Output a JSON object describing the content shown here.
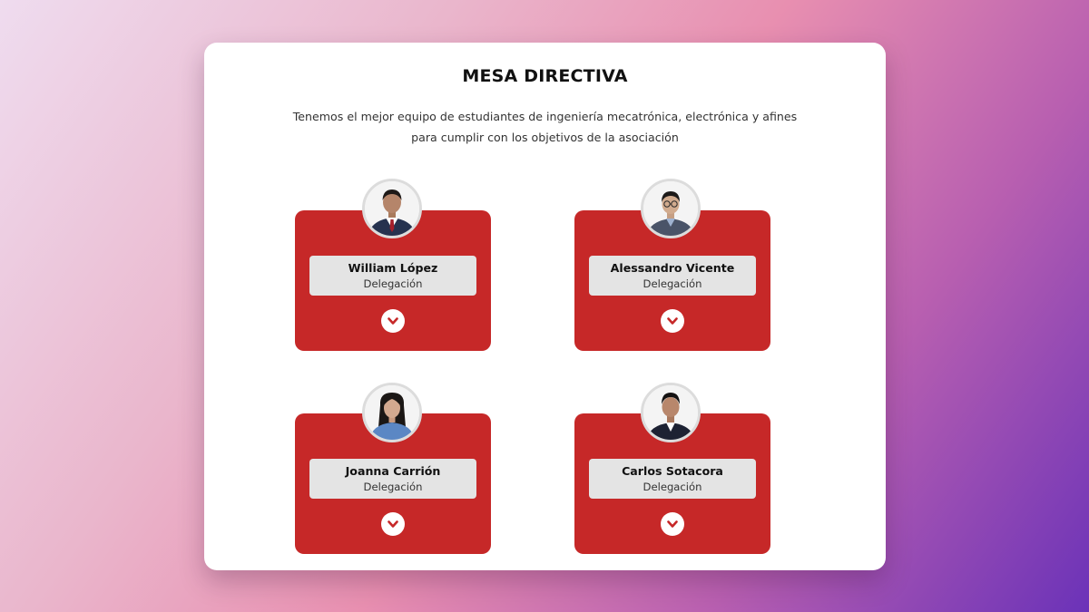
{
  "section": {
    "title": "MESA DIRECTIVA",
    "subtitle_line1": "Tenemos el mejor equipo de estudiantes de ingeniería mecatrónica, electrónica y afines",
    "subtitle_line2": "para cumplir con los objetivos de la asociación"
  },
  "members": [
    {
      "name": "William López",
      "role": "Delegación",
      "photo": "person-photo-male-suit-red-tie",
      "toggle_icon": "chevron-down-icon"
    },
    {
      "name": "Alessandro Vicente",
      "role": "Delegación",
      "photo": "person-photo-male-glasses-suit",
      "toggle_icon": "chevron-down-icon"
    },
    {
      "name": "Joanna Carrión",
      "role": "Delegación",
      "photo": "person-photo-female-blue-blouse",
      "toggle_icon": "chevron-down-icon"
    },
    {
      "name": "Carlos Sotacora",
      "role": "Delegación",
      "photo": "person-photo-male-dark-suit",
      "toggle_icon": "chevron-down-icon"
    }
  ],
  "colors": {
    "card_background": "#c62828",
    "name_box_background": "#e4e4e4",
    "panel_background": "#ffffff",
    "page_gradient_start": "#efdcef",
    "page_gradient_end": "#6b32b8"
  }
}
